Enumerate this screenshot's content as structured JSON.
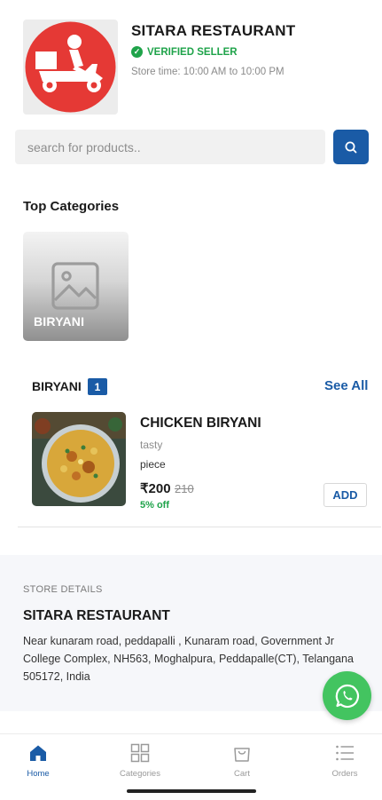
{
  "store": {
    "name": "SITARA RESTAURANT",
    "verified_label": "VERIFIED SELLER",
    "store_time": "Store time: 10:00 AM to 10:00 PM",
    "logo_icon": "delivery-scooter-icon"
  },
  "search": {
    "placeholder": "search for products..",
    "button_icon": "search-icon"
  },
  "top_categories": {
    "title": "Top Categories",
    "items": [
      {
        "label": "BIRYANI",
        "icon": "image-placeholder-icon"
      }
    ]
  },
  "product_section": {
    "title": "BIRYANI",
    "count": "1",
    "see_all": "See All",
    "products": [
      {
        "name": "CHICKEN BIRYANI",
        "description": "tasty",
        "unit": "piece",
        "price": "₹200",
        "mrp": "210",
        "discount": "5% off",
        "add_label": "ADD"
      }
    ]
  },
  "store_details": {
    "section_label": "STORE DETAILS",
    "name": "SITARA RESTAURANT",
    "address": "Near kunaram road, peddapalli , Kunaram road, Government Jr College Complex, NH563, Moghalpura, Peddapalle(CT), Telangana 505172, India"
  },
  "whatsapp": {
    "icon": "whatsapp-icon"
  },
  "bottom_nav": {
    "active": "Home",
    "items": [
      {
        "label": "Home",
        "icon": "home-icon"
      },
      {
        "label": "Categories",
        "icon": "grid-icon"
      },
      {
        "label": "Cart",
        "icon": "cart-icon"
      },
      {
        "label": "Orders",
        "icon": "list-icon"
      }
    ]
  },
  "colors": {
    "primary": "#1a5ba6",
    "logo_red": "#e53935",
    "success_green": "#1fa34a",
    "whatsapp_green": "#43c460"
  }
}
